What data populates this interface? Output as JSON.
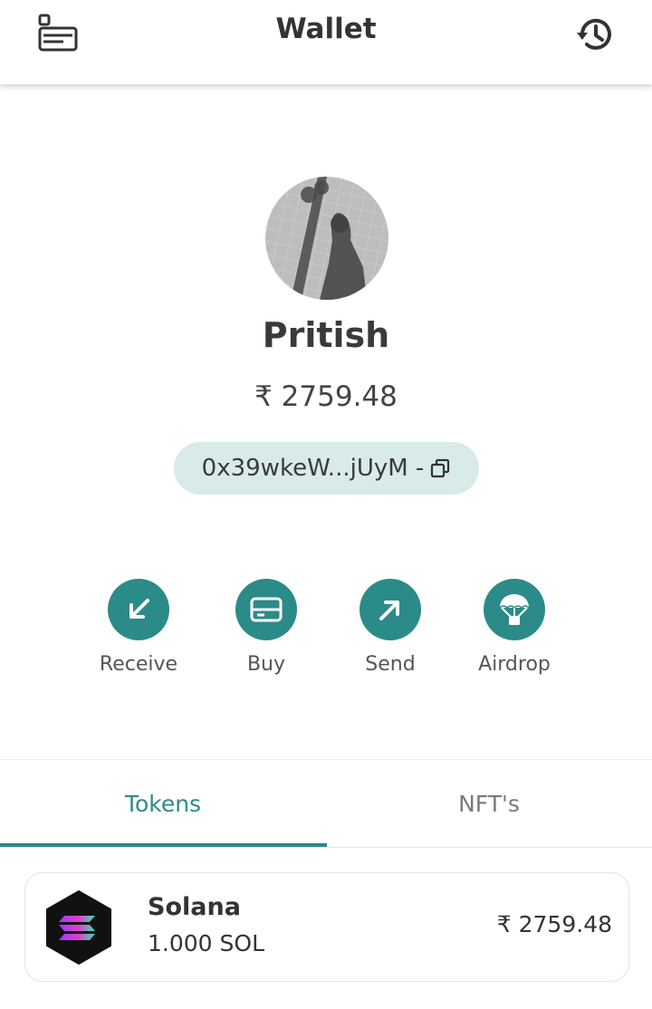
{
  "header": {
    "title": "Wallet",
    "left_icon": "wallet-card-icon",
    "right_icon": "history-icon"
  },
  "profile": {
    "name": "Pritish",
    "balance": "₹ 2759.48",
    "address": "0x39wkeW...jUyM -"
  },
  "actions": [
    {
      "label": "Receive",
      "icon": "arrow-down-left-icon"
    },
    {
      "label": "Buy",
      "icon": "card-icon"
    },
    {
      "label": "Send",
      "icon": "arrow-up-right-icon"
    },
    {
      "label": "Airdrop",
      "icon": "parachute-icon"
    }
  ],
  "tabs": [
    {
      "label": "Tokens",
      "active": true
    },
    {
      "label": "NFT's",
      "active": false
    }
  ],
  "tokens": [
    {
      "name": "Solana",
      "amount": "1.000 SOL",
      "value": "₹ 2759.48",
      "icon": "solana-logo-icon"
    }
  ],
  "colors": {
    "accent": "#2b8b88",
    "address_bg": "#d8eaea",
    "text": "#333333"
  }
}
